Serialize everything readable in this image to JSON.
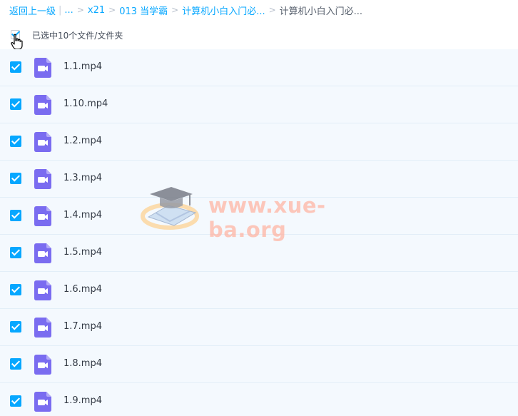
{
  "breadcrumb": {
    "back_label": "返回上一级",
    "ellipsis": "...",
    "items": [
      "x21",
      "013 当学霸",
      "计算机小白入门必..."
    ],
    "current": "计算机小白入门必..."
  },
  "selection": {
    "summary": "已选中10个文件/文件夹"
  },
  "files": [
    {
      "name": "1.1.mp4"
    },
    {
      "name": "1.10.mp4"
    },
    {
      "name": "1.2.mp4"
    },
    {
      "name": "1.3.mp4"
    },
    {
      "name": "1.4.mp4"
    },
    {
      "name": "1.5.mp4"
    },
    {
      "name": "1.6.mp4"
    },
    {
      "name": "1.7.mp4"
    },
    {
      "name": "1.8.mp4"
    },
    {
      "name": "1.9.mp4"
    }
  ],
  "watermark": {
    "text": "www.xue-ba.org",
    "icon": "graduation-cap-book-icon"
  },
  "colors": {
    "accent": "#06a7ff",
    "video_icon": "#7a6cf0",
    "row_bg": "#f4f9fe"
  }
}
